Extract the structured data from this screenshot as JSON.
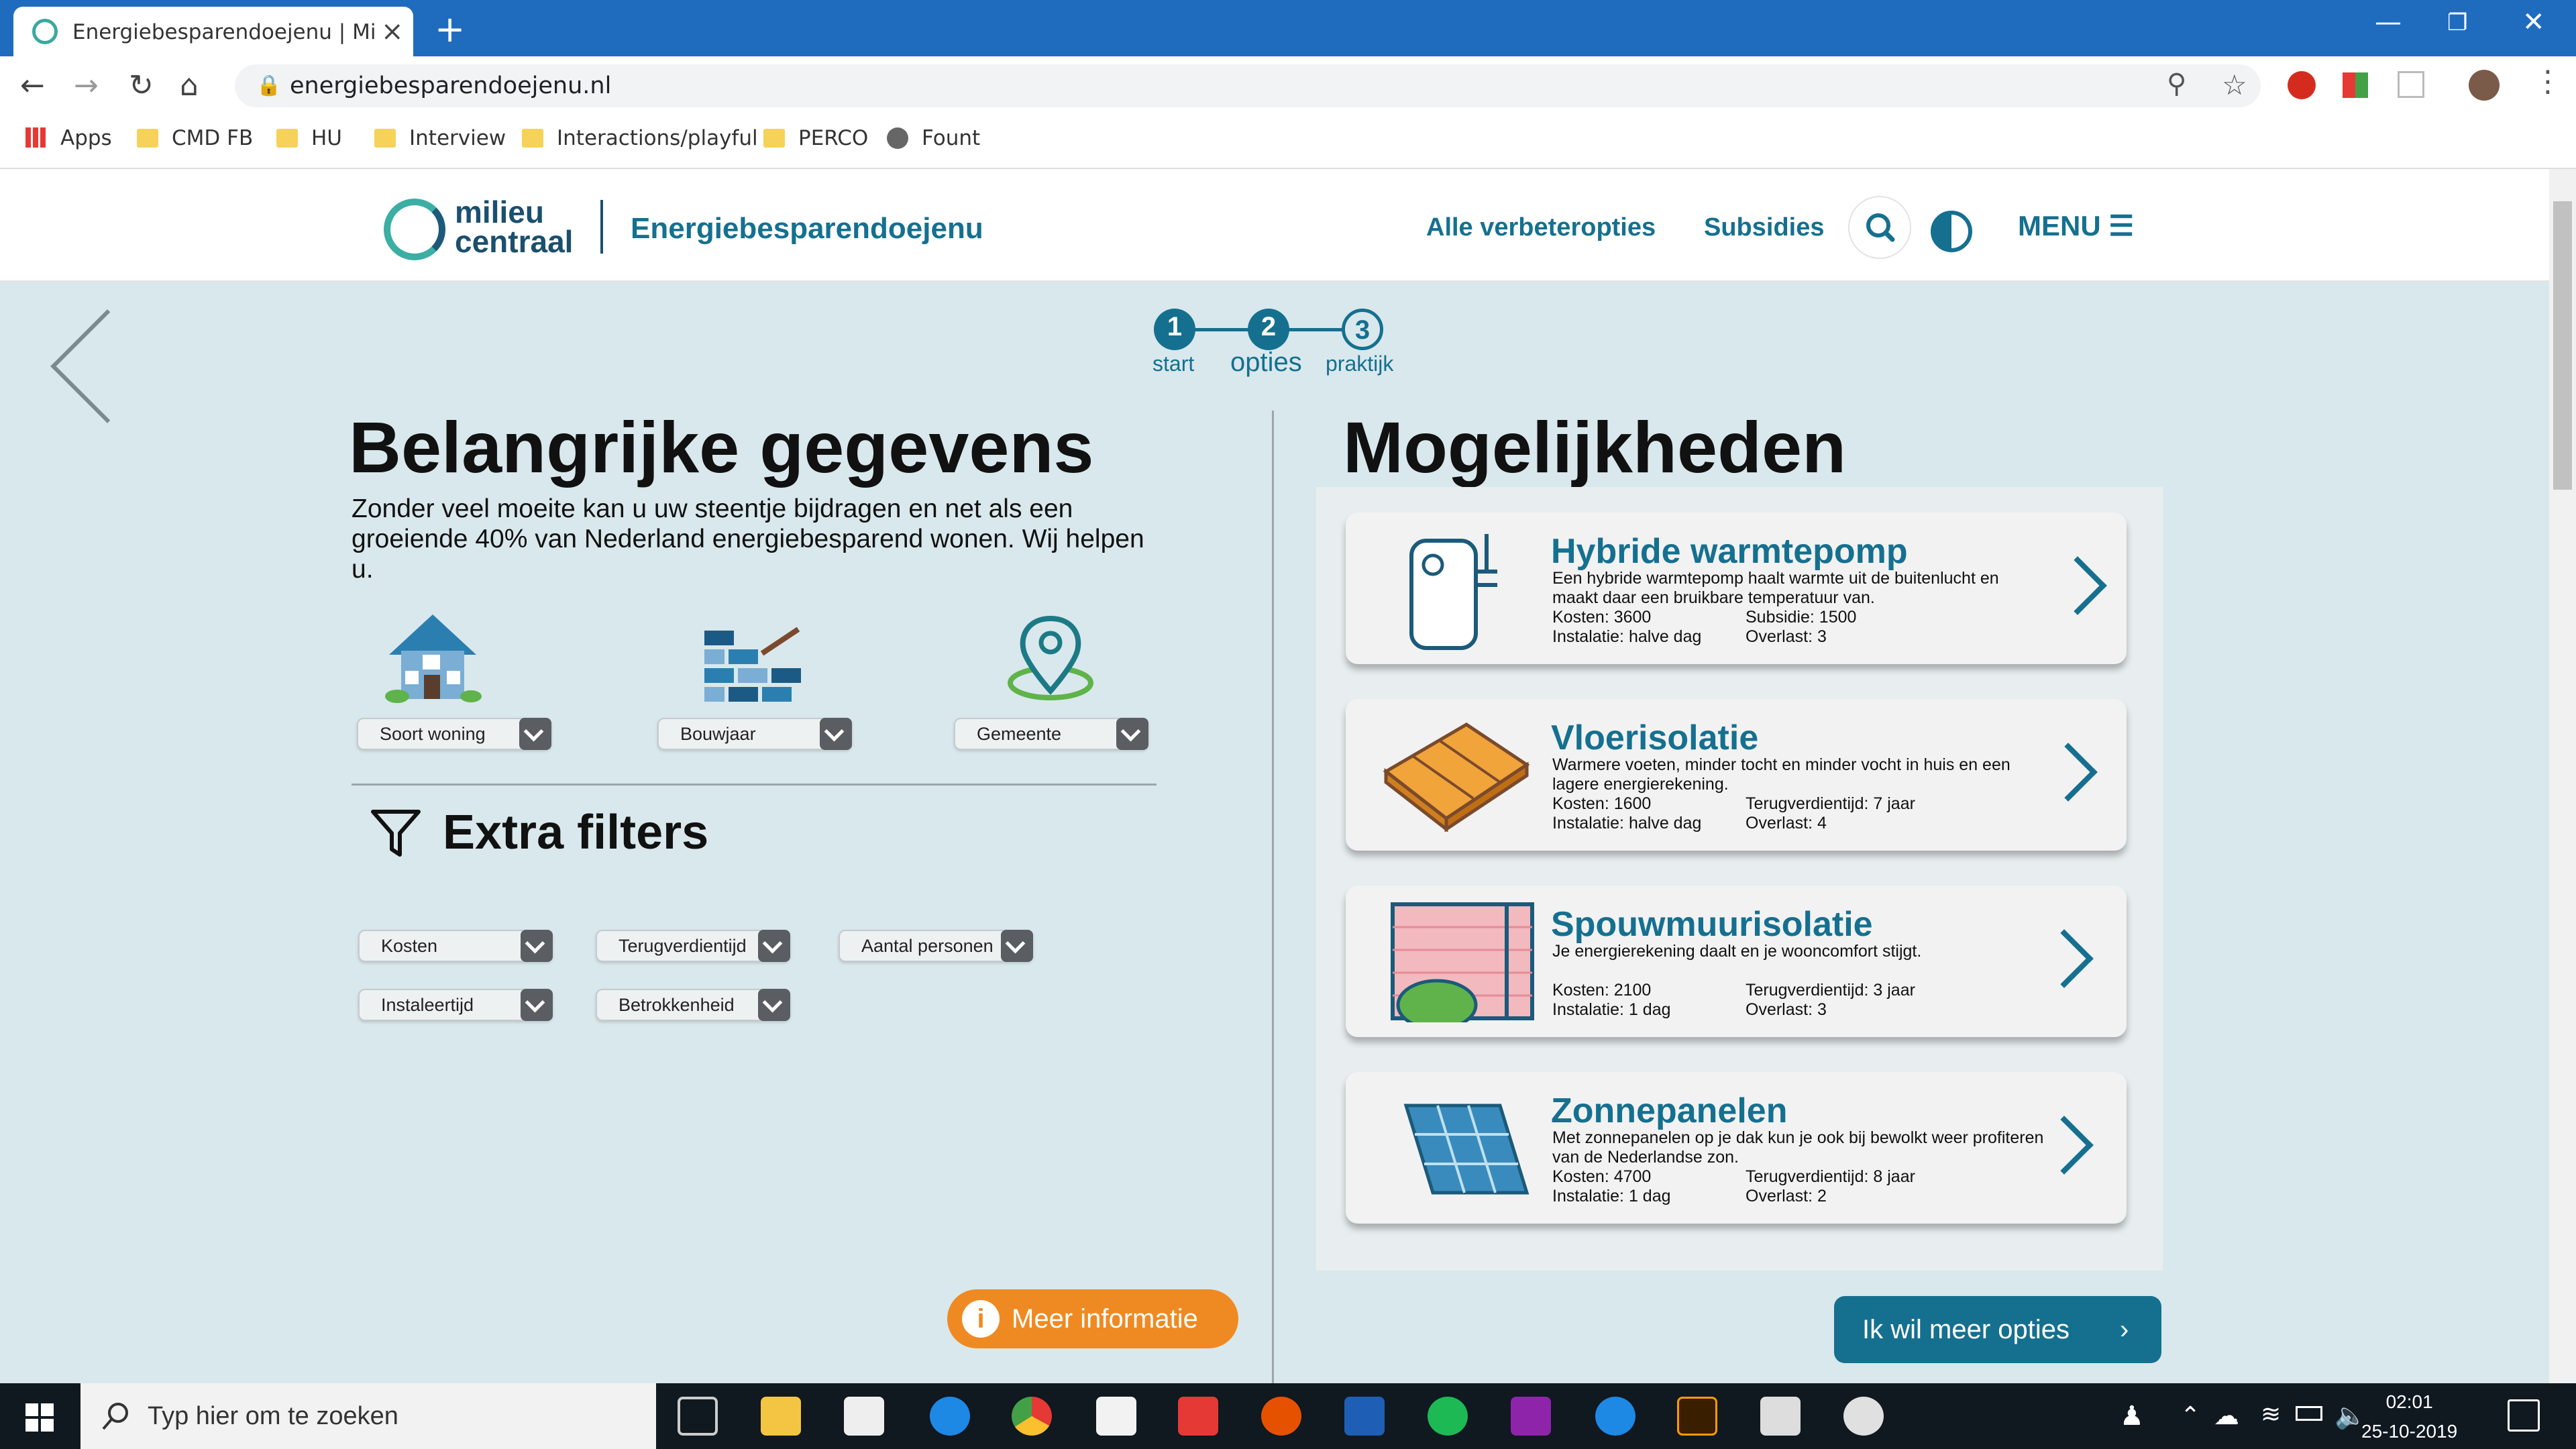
{
  "browser": {
    "tab_title": "Energiebesparendoejenu | Milieu",
    "url": "energiebesparendoejenu.nl",
    "bookmarks": [
      "Apps",
      "CMD FB",
      "HU",
      "Interview",
      "Interactions/playful",
      "PERCO",
      "Fount"
    ]
  },
  "site": {
    "logo_text_1": "milieu",
    "logo_text_2": "centraal",
    "brand": "Energiebesparendoejenu",
    "nav": [
      "Alle verbeteropties",
      "Subsidies"
    ],
    "menu": "MENU",
    "steps": [
      {
        "num": "1",
        "label": "start"
      },
      {
        "num": "2",
        "label": "opties"
      },
      {
        "num": "3",
        "label": "praktijk"
      }
    ]
  },
  "left": {
    "title": "Belangrijke gegevens",
    "intro": "Zonder veel moeite kan u uw steentje bijdragen en net als een groeiende 40% van Nederland energiebesparend wonen. Wij helpen u.",
    "selectors": [
      "Soort woning",
      "Bouwjaar",
      "Gemeente"
    ],
    "filters_title": "Extra filters",
    "filters": [
      "Kosten",
      "Terugverdientijd",
      "Aantal personen",
      "Instaleertijd",
      "Betrokkenheid"
    ],
    "more_info": "Meer informatie"
  },
  "right": {
    "title": "Mogelijkheden",
    "cards": [
      {
        "title": "Hybride warmtepomp",
        "desc": "Een hybride warmtepomp haalt warmte uit de buitenlucht en maakt daar een bruikbare temperatuur van.",
        "k1": "Kosten: 3600",
        "k2": "Subsidie: 1500",
        "k3": "Instalatie: halve dag",
        "k4": "Overlast: 3"
      },
      {
        "title": "Vloerisolatie",
        "desc": "Warmere voeten, minder tocht en minder vocht in huis en een lagere energierekening.",
        "k1": "Kosten: 1600",
        "k2": "Terugverdientijd: 7 jaar",
        "k3": "Instalatie: halve dag",
        "k4": "Overlast: 4"
      },
      {
        "title": "Spouwmuurisolatie",
        "desc": "Je energierekening daalt en je wooncomfort stijgt.",
        "k1": "Kosten: 2100",
        "k2": "Terugverdientijd: 3 jaar",
        "k3": "Instalatie: 1 dag",
        "k4": "Overlast: 3"
      },
      {
        "title": "Zonnepanelen",
        "desc": "Met zonnepanelen op je dak kun je ook bij bewolkt weer profiteren van de Nederlandse zon.",
        "k1": "Kosten: 4700",
        "k2": "Terugverdientijd: 8 jaar",
        "k3": "Instalatie: 1 dag",
        "k4": "Overlast: 2"
      }
    ],
    "more_options": "Ik wil meer opties"
  },
  "taskbar": {
    "search": "Typ hier om te zoeken",
    "time": "02:01",
    "date": "25-10-2019"
  },
  "colors": {
    "primary": "#157090",
    "orange": "#ef8a22",
    "page_bg": "#d9e8ec",
    "tabbar": "#1f6cbf"
  }
}
